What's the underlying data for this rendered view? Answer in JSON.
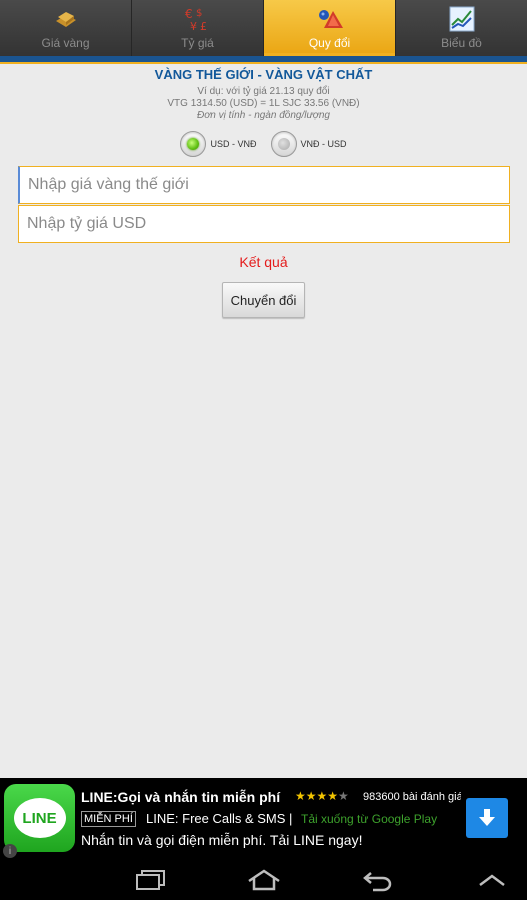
{
  "tabs": [
    {
      "label": "Giá vàng",
      "icon": "gold-bar-icon",
      "active": false
    },
    {
      "label": "Tỷ giá",
      "icon": "currency-symbols-icon",
      "active": false
    },
    {
      "label": "Quy đổi",
      "icon": "conversion-icon",
      "active": true
    },
    {
      "label": "Biểu đồ",
      "icon": "chart-icon",
      "active": false
    }
  ],
  "converter": {
    "subtitle": "VÀNG THẾ GIỚI - VÀNG VẬT CHẤT",
    "example_line1": "Ví dụ: với tỷ giá 21.13 quy đổi",
    "example_line2": "VTG 1314.50 (USD) = 1L SJC 33.56 (VNĐ)",
    "unit_note": "Đơn vị tính - ngàn đồng/lượng",
    "radio_usd_vnd": "USD - VNĐ",
    "radio_vnd_usd": "VNĐ - USD",
    "selected": "USD - VNĐ",
    "world_gold_placeholder": "Nhập giá vàng thế giới",
    "usd_rate_placeholder": "Nhập tỷ giá USD",
    "result_label": "Kết quả",
    "convert_button": "Chuyển đổi"
  },
  "ad": {
    "logo_text": "LINE",
    "title": "LINE:Gọi và nhắn tin miễn phí",
    "rating_stars": 4,
    "reviews": "983600 bài đánh giá",
    "free_badge": "MIỄN PHÍ",
    "app_name": "LINE: Free Calls & SMS |",
    "store_text": "Tải xuống từ Google Play",
    "description": "Nhắn tin và gọi điện miễn phí. Tải LINE ngay!",
    "info_glyph": "i",
    "brand_color": "#1fa51f",
    "download_color": "#1e88e5"
  },
  "colors": {
    "accent": "#f0b020",
    "header_blue": "#1a5490",
    "result_red": "#e41b1b"
  }
}
